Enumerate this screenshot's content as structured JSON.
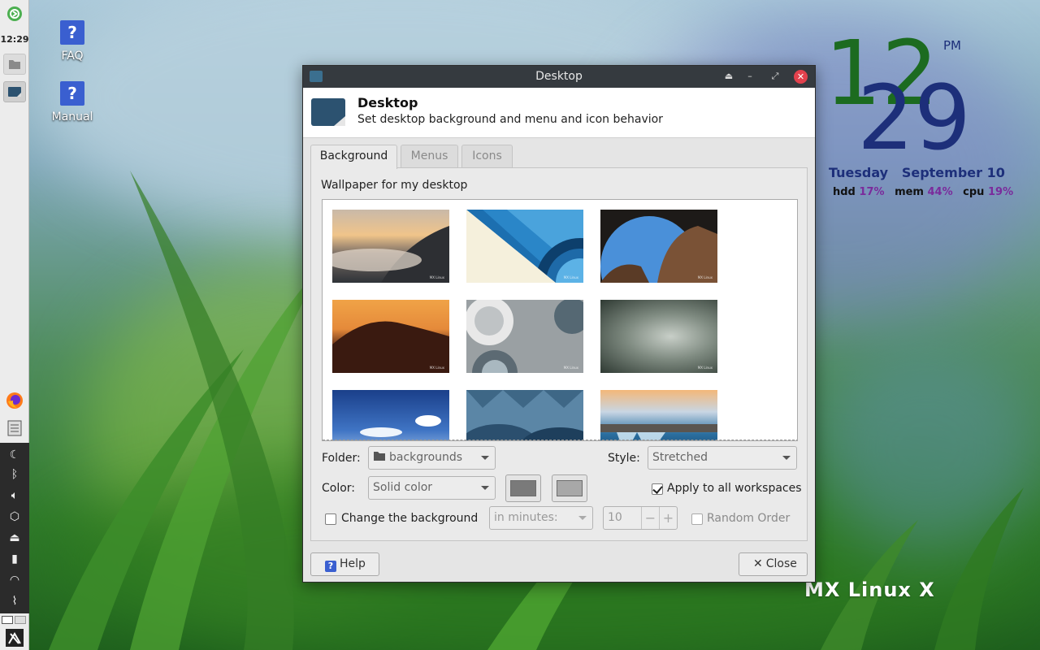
{
  "panel": {
    "clock": "12:29"
  },
  "desktop_icons": [
    {
      "label": "FAQ"
    },
    {
      "label": "Manual"
    }
  ],
  "conky": {
    "hour": "12",
    "minute": "29",
    "ampm": "PM",
    "date": "Tuesday   September 10",
    "hdd_label": "hdd",
    "hdd_value": "17%",
    "mem_label": "mem",
    "mem_value": "44%",
    "cpu_label": "cpu",
    "cpu_value": "19%"
  },
  "brand": {
    "logo_text": "MX Linux X"
  },
  "window": {
    "title": "Desktop",
    "header_title": "Desktop",
    "header_subtitle": "Set desktop background and menu and icon behavior",
    "tabs": [
      {
        "label": "Background",
        "active": true
      },
      {
        "label": "Menus",
        "active": false
      },
      {
        "label": "Icons",
        "active": false
      }
    ],
    "wallpaper_label": "Wallpaper for my desktop",
    "thumbnail_watermark": "MX Linux",
    "folder_label": "Folder:",
    "folder_value": "backgrounds",
    "style_label": "Style:",
    "style_value": "Stretched",
    "color_label": "Color:",
    "color_value": "Solid color",
    "color1": "#7a7a7a",
    "color2": "#a8a8a8",
    "apply_all_label": "Apply to all workspaces",
    "apply_all_checked": true,
    "change_bg_label": "Change the background",
    "change_bg_checked": false,
    "interval_unit": "in minutes:",
    "interval_value": "10",
    "random_order_label": "Random Order",
    "random_order_checked": false,
    "help_label": "Help",
    "close_label": "Close"
  },
  "colors": {
    "titlebar": "#353a3f",
    "close_button": "#e2414d",
    "accent_blue": "#3a5fd0",
    "conky_green": "#1c6b20",
    "conky_navy": "#1d2f7a",
    "conky_purple": "#7a2b9c"
  }
}
